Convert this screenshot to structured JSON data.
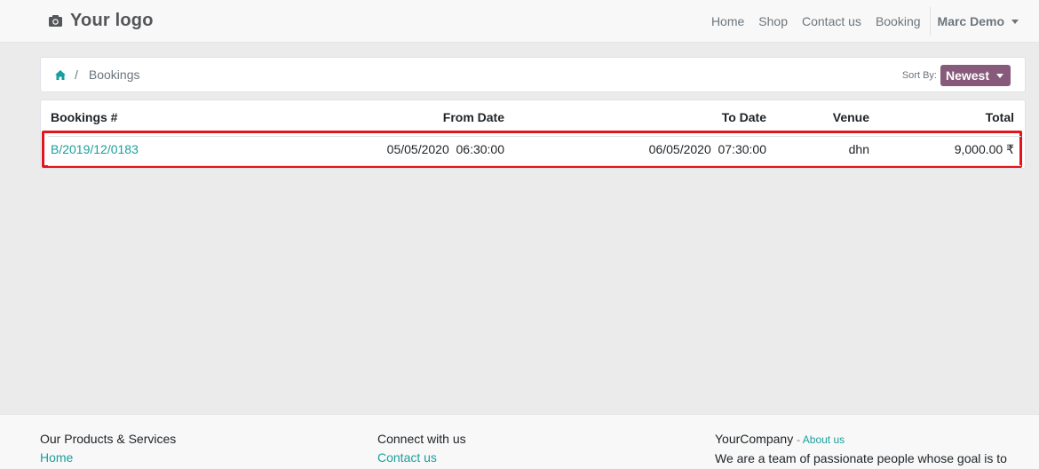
{
  "header": {
    "logo_text": "Your logo",
    "nav": [
      "Home",
      "Shop",
      "Contact us",
      "Booking"
    ],
    "user_name": "Marc Demo"
  },
  "breadcrumb": {
    "current": "Bookings",
    "separator": "/"
  },
  "sort": {
    "label": "Sort By:",
    "value": "Newest"
  },
  "table": {
    "columns": [
      "Bookings #",
      "From Date",
      "To Date",
      "Venue",
      "Total"
    ],
    "rows": [
      {
        "booking": "B/2019/12/0183",
        "from_date": "05/05/2020  06:30:00",
        "to_date": "06/05/2020  07:30:00",
        "venue": "dhn",
        "total": "9,000.00 ₹"
      }
    ]
  },
  "footer": {
    "col1": {
      "heading": "Our Products & Services",
      "link": "Home"
    },
    "col2": {
      "heading": "Connect with us",
      "link": "Contact us"
    },
    "col3": {
      "heading": "YourCompany",
      "about_prefix": "- ",
      "about_link": "About us",
      "text": "We are a team of passionate people whose goal is to"
    }
  },
  "colors": {
    "brand": "#875a7b",
    "link": "#1a9f9c",
    "highlight": "#e3151a"
  }
}
